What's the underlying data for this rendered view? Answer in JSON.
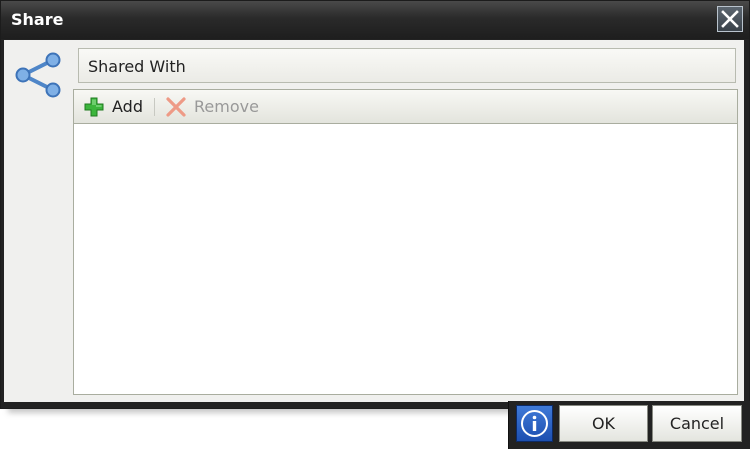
{
  "dialog": {
    "title": "Share",
    "close_icon": "close-icon"
  },
  "share_icon": "share-icon",
  "field": {
    "label": "Shared With"
  },
  "toolbar": {
    "add_label": "Add",
    "add_icon": "plus-icon",
    "remove_label": "Remove",
    "remove_icon": "x-icon",
    "remove_enabled": false
  },
  "list": {
    "items": []
  },
  "footer": {
    "info_icon": "info-icon",
    "ok_label": "OK",
    "cancel_label": "Cancel"
  },
  "colors": {
    "titlebar": "#2a2a2a",
    "accent_blue": "#1d4fb0",
    "add_green": "#2fa62f",
    "remove_red": "#e05a3a",
    "share_blue": "#4f86c8"
  }
}
